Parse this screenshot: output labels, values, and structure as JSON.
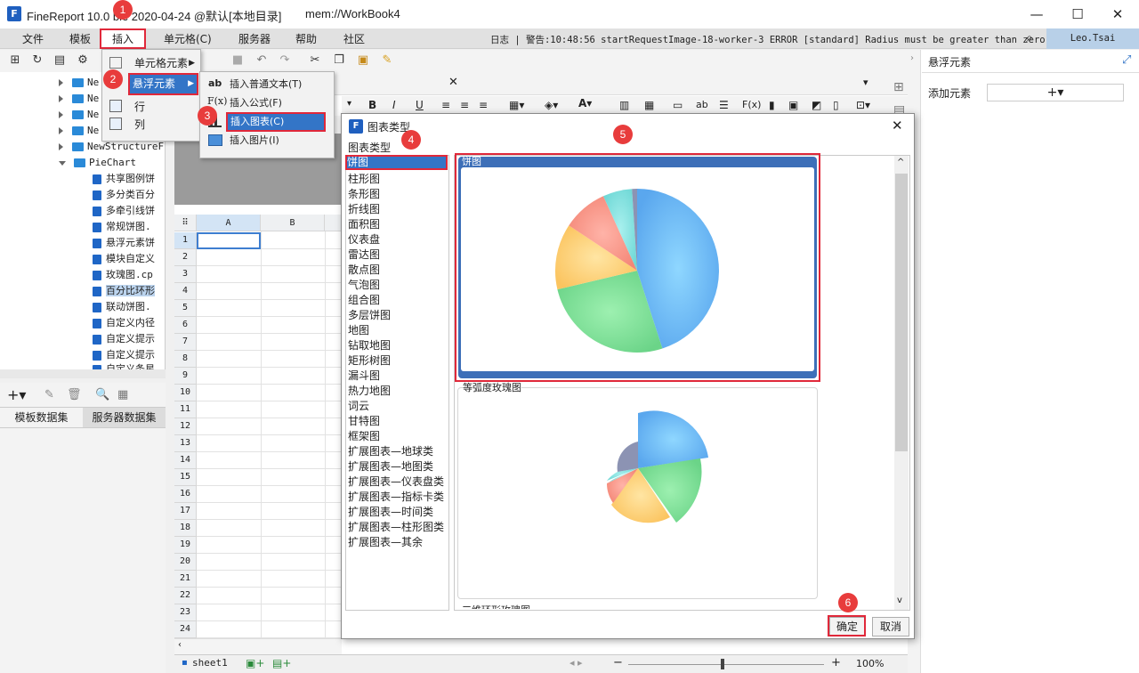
{
  "window": {
    "title": "FineReport 10.0 ",
    "title_tail": "ble 2020-04-24 @默认[本地目录]",
    "path": "mem://WorkBook4",
    "min": "—",
    "max": "☐",
    "close": "✕"
  },
  "menu": [
    "文件",
    "模板",
    "插入",
    "单元格(C)",
    "服务器",
    "帮助",
    "社区"
  ],
  "log_text": "日志 | 警告:10:48:56 startRequestImage-18-worker-3 ERROR [standard] Radius must be greater than zero",
  "user": "Leo.Tsai",
  "tree": {
    "partial_items": [
      "Ne",
      "Ne",
      "Ne",
      "Ne",
      "NewStructureF"
    ],
    "folder": "PieChart",
    "files": [
      "共享图例饼",
      "多分类百分",
      "多牵引线饼",
      "常规饼图.",
      "悬浮元素饼",
      "模块自定义",
      "玫瑰图.cp",
      "百分比环形",
      "联动饼图.",
      "自定义内径",
      "自定义提示",
      "自定义提示",
      "自定义条星"
    ]
  },
  "datasets": {
    "tab1": "模板数据集",
    "tab2": "服务器数据集"
  },
  "insert_menu": {
    "cell_element": "单元格元素",
    "float_element": "悬浮元素",
    "row": "行",
    "col": "列"
  },
  "float_submenu": {
    "text": "插入普通文本(T)",
    "formula": "插入公式(F)",
    "chart": "插入图表(C)",
    "image": "插入图片(I)"
  },
  "grid": {
    "cols": [
      "A",
      "B"
    ],
    "rows": [
      "1",
      "2",
      "3",
      "4",
      "5",
      "6",
      "7",
      "8",
      "9",
      "10",
      "11",
      "12",
      "13",
      "14",
      "15",
      "16",
      "17",
      "18",
      "19",
      "20",
      "21",
      "22",
      "23",
      "24"
    ],
    "sheet": "sheet1",
    "zoom": "100%"
  },
  "right_panel": {
    "title": "悬浮元素",
    "add_label": "添加元素",
    "add_btn": "+▾"
  },
  "dialog": {
    "title": "图表类型",
    "list_header": "图表类型",
    "types": [
      "饼图",
      "柱形图",
      "条形图",
      "折线图",
      "面积图",
      "仪表盘",
      "雷达图",
      "散点图",
      "气泡图",
      "组合图",
      "多层饼图",
      "地图",
      "钻取地图",
      "矩形树图",
      "漏斗图",
      "热力地图",
      "词云",
      "甘特图",
      "框架图",
      "扩展图表—地球类",
      "扩展图表—地图类",
      "扩展图表—仪表盘类",
      "扩展图表—指标卡类",
      "扩展图表—时间类",
      "扩展图表—柱形图类",
      "扩展图表—其余"
    ],
    "preview1": "饼图",
    "preview2": "等弧度玫瑰图",
    "ok": "确定",
    "cancel": "取消"
  },
  "badges": [
    "1",
    "2",
    "3",
    "4",
    "5",
    "6"
  ],
  "colors": {
    "accent": "#3375c7",
    "highlight_red": "#e0283a",
    "pie": [
      "#66b3f0",
      "#77dd8f",
      "#ffd27a",
      "#f8988a",
      "#82e0de",
      "#8c93b3"
    ]
  }
}
